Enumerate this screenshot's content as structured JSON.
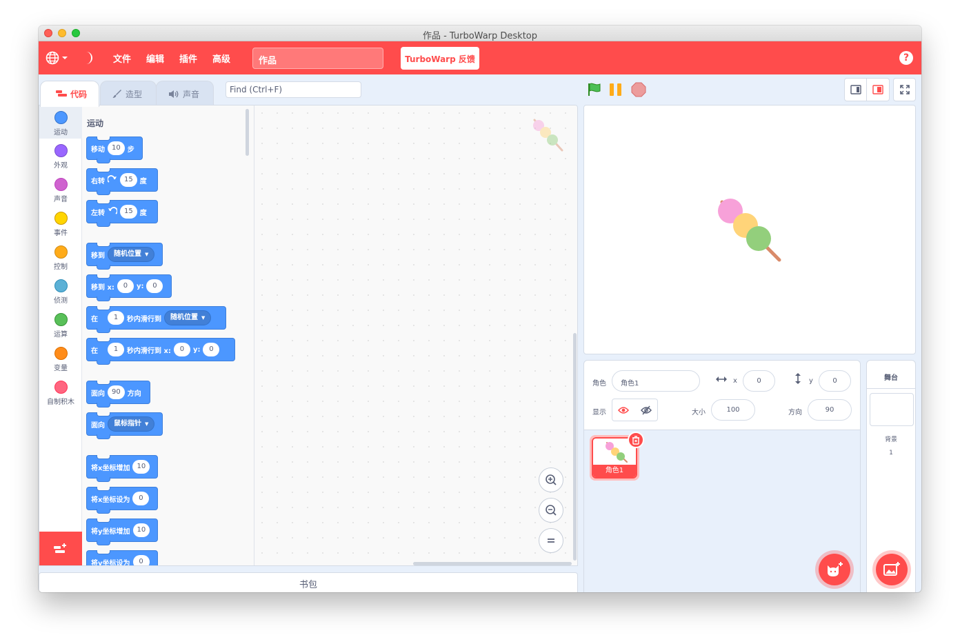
{
  "window": {
    "title": "作品 - TurboWarp Desktop"
  },
  "menubar": {
    "items": [
      "文件",
      "编辑",
      "插件",
      "高级"
    ],
    "project_title": "作品",
    "feedback_label": "TurboWarp 反馈",
    "help_label": "?"
  },
  "tabs": [
    {
      "label": "代码",
      "active": true
    },
    {
      "label": "造型",
      "active": false
    },
    {
      "label": "声音",
      "active": false
    }
  ],
  "find": {
    "placeholder": "Find (Ctrl+F)"
  },
  "categories": [
    {
      "label": "运动",
      "color": "#4c97ff"
    },
    {
      "label": "外观",
      "color": "#9966ff"
    },
    {
      "label": "声音",
      "color": "#cf63cf"
    },
    {
      "label": "事件",
      "color": "#ffd500"
    },
    {
      "label": "控制",
      "color": "#ffab19"
    },
    {
      "label": "侦测",
      "color": "#5cb1d6"
    },
    {
      "label": "运算",
      "color": "#59c059"
    },
    {
      "label": "变量",
      "color": "#ff8c1a"
    },
    {
      "label": "自制积木",
      "color": "#ff6680"
    }
  ],
  "palette": {
    "title": "运动",
    "blocks": {
      "move": {
        "a": "移动",
        "v": "10",
        "b": "步"
      },
      "turn_right": {
        "a": "右转",
        "v": "15",
        "b": "度"
      },
      "turn_left": {
        "a": "左转",
        "v": "15",
        "b": "度"
      },
      "goto": {
        "a": "移到",
        "d": "随机位置"
      },
      "goto_xy": {
        "a": "移到 x:",
        "x": "0",
        "b": "y:",
        "y": "0"
      },
      "glide": {
        "a": "在",
        "v": "1",
        "b": "秒内滑行到",
        "d": "随机位置"
      },
      "glide_xy": {
        "a": "在",
        "v": "1",
        "b": "秒内滑行到 x:",
        "x": "0",
        "c": "y:",
        "y": "0"
      },
      "point": {
        "a": "面向",
        "v": "90",
        "b": "方向"
      },
      "point_towards": {
        "a": "面向",
        "d": "鼠标指针"
      },
      "change_x": {
        "a": "将x坐标增加",
        "v": "10"
      },
      "set_x": {
        "a": "将x坐标设为",
        "v": "0"
      },
      "change_y": {
        "a": "将y坐标增加",
        "v": "10"
      },
      "set_y": {
        "a": "将y坐标设为",
        "v": "0"
      }
    }
  },
  "backpack": {
    "label": "书包"
  },
  "sprite_info": {
    "sprite_label": "角色",
    "sprite_name": "角色1",
    "x_label": "x",
    "x_value": "0",
    "y_label": "y",
    "y_value": "0",
    "show_label": "显示",
    "size_label": "大小",
    "size_value": "100",
    "direction_label": "方向",
    "direction_value": "90"
  },
  "sprites": [
    {
      "name": "角色1",
      "selected": true
    }
  ],
  "stage_selector": {
    "title": "舞台",
    "backdrops_label": "背景",
    "backdrops_count": "1"
  },
  "colors": {
    "accent": "#ff4c4c",
    "motion": "#4c97ff",
    "panel_bg": "#e8f0fb"
  }
}
